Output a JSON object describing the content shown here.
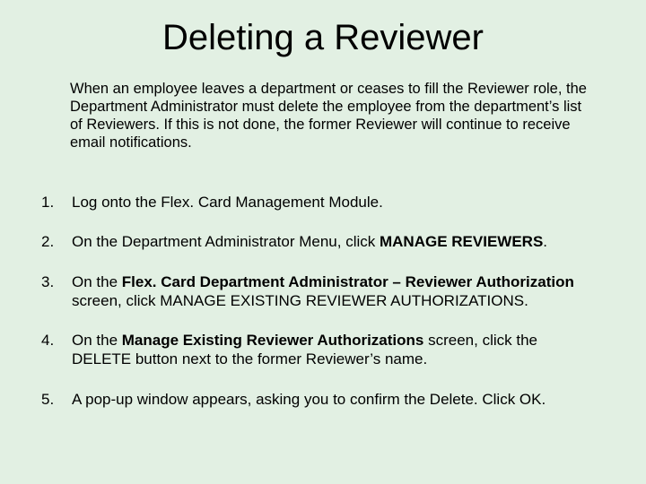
{
  "title": "Deleting a Reviewer",
  "intro": "When an employee leaves a department or ceases to fill the Reviewer role, the Department Administrator must delete the employee from the department’s list of Reviewers.  If this is not done, the former Reviewer will continue to receive email notifications.",
  "steps": [
    {
      "num": "1.",
      "parts": [
        {
          "text": "Log onto the Flex. Card Management Module.",
          "bold": false
        }
      ]
    },
    {
      "num": "2.",
      "parts": [
        {
          "text": "On the Department Administrator Menu, click ",
          "bold": false
        },
        {
          "text": "MANAGE REVIEWERS",
          "bold": true
        },
        {
          "text": ".",
          "bold": false
        }
      ]
    },
    {
      "num": "3.",
      "parts": [
        {
          "text": "On the ",
          "bold": false
        },
        {
          "text": "Flex. Card Department Administrator – Reviewer Authorization",
          "bold": true
        },
        {
          "text": " screen, click MANAGE EXISTING REVIEWER AUTHORIZATIONS.",
          "bold": false
        }
      ]
    },
    {
      "num": "4.",
      "parts": [
        {
          "text": "On the ",
          "bold": false
        },
        {
          "text": "Manage Existing Reviewer Authorizations",
          "bold": true
        },
        {
          "text": " screen, click the DELETE button next to the former Reviewer’s name.",
          "bold": false
        }
      ]
    },
    {
      "num": "5.",
      "parts": [
        {
          "text": "A pop-up window appears, asking you to confirm the Delete.  Click OK.",
          "bold": false
        }
      ]
    }
  ]
}
